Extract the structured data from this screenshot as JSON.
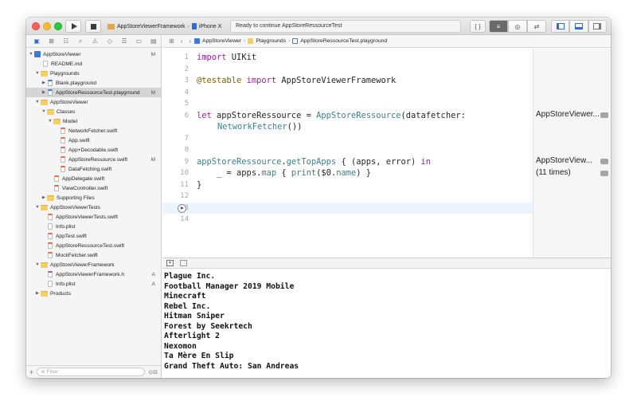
{
  "toolbar": {
    "scheme_target": "AppStoreViewerFramework",
    "scheme_device": "iPhone X",
    "activity_status": "Ready to continue AppStoreRessourceTest",
    "braces_label": "{ }"
  },
  "navigator": {
    "filter_placeholder": "Filter",
    "items": [
      {
        "label": "AppStoreViewer",
        "flag": "M"
      },
      {
        "label": "README.md",
        "flag": ""
      },
      {
        "label": "Playgrounds",
        "flag": ""
      },
      {
        "label": "Blank.playground",
        "flag": ""
      },
      {
        "label": "AppStoreRessourceTest.playground",
        "flag": "M"
      },
      {
        "label": "AppStoreViewer",
        "flag": ""
      },
      {
        "label": "Classes",
        "flag": ""
      },
      {
        "label": "Model",
        "flag": ""
      },
      {
        "label": "NetworkFetcher.swift",
        "flag": ""
      },
      {
        "label": "App.swift",
        "flag": ""
      },
      {
        "label": "App+Decodable.swift",
        "flag": ""
      },
      {
        "label": "AppStoreRessource.swift",
        "flag": "M"
      },
      {
        "label": "DataFetching.swift",
        "flag": ""
      },
      {
        "label": "AppDelegate.swift",
        "flag": ""
      },
      {
        "label": "ViewController.swift",
        "flag": ""
      },
      {
        "label": "Supporting Files",
        "flag": ""
      },
      {
        "label": "AppStoreViewerTests",
        "flag": ""
      },
      {
        "label": "AppStoreViewerTests.swift",
        "flag": ""
      },
      {
        "label": "Info.plist",
        "flag": ""
      },
      {
        "label": "AppTest.swift",
        "flag": ""
      },
      {
        "label": "AppStoreRessourceTest.swift",
        "flag": ""
      },
      {
        "label": "MockFetcher.swift",
        "flag": ""
      },
      {
        "label": "AppStoreViewerFramework",
        "flag": ""
      },
      {
        "label": "AppStoreViewerFramework.h",
        "flag": "A"
      },
      {
        "label": "Info.plist",
        "flag": "A"
      },
      {
        "label": "Products",
        "flag": ""
      }
    ]
  },
  "jumpbar": {
    "crumbs": [
      "AppStoreViewer",
      "Playgrounds",
      "AppStoreRessourceTest.playground"
    ]
  },
  "editor": {
    "line_numbers": [
      "1",
      "2",
      "3",
      "4",
      "5",
      "6",
      "",
      "7",
      "8",
      "9",
      "10",
      "11",
      "12",
      "13",
      "14"
    ],
    "lines": {
      "l1_kw": "import",
      "l1_rest": " UIKit",
      "l3_attr": "@testable",
      "l3_kw": " import",
      "l3_rest": " AppStoreViewerFramework",
      "l6_kw": "let",
      "l6_a": " appStoreRessource = ",
      "l6_ty": "AppStoreRessource",
      "l6_b": "(datafetcher:",
      "l6c_ty": "NetworkFetcher",
      "l6c_b": "())",
      "l9_ty": "appStoreRessource",
      "l9_a": ".",
      "l9_ty2": "getTopApps",
      "l9_b": " { (apps, error) ",
      "l9_kw": "in",
      "l10_a": "    _ = apps.",
      "l10_ty": "map",
      "l10_b": " { ",
      "l10_ty2": "print",
      "l10_c": "($0.",
      "l10_ty3": "name",
      "l10_d": ") }",
      "l11": "}"
    }
  },
  "results": {
    "r6": "AppStoreViewer...",
    "r9": "AppStoreView...",
    "r10": "(11 times)"
  },
  "console": {
    "lines": [
      "Plague Inc.",
      "Football Manager 2019 Mobile",
      "Minecraft",
      "Rebel Inc.",
      "Hitman Sniper",
      "Forest by Seekrtech",
      "Afterlight 2",
      "Nexomon",
      "Ta Mère En Slip",
      "Grand Theft Auto: San Andreas"
    ]
  }
}
